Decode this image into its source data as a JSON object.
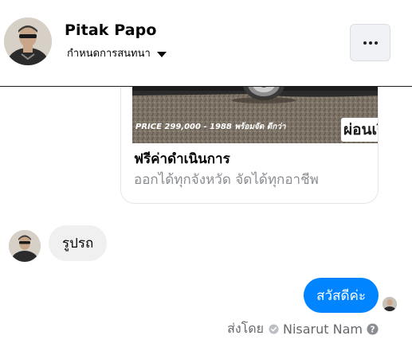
{
  "header": {
    "name": "Pitak Papo",
    "subtitle": "กำหนดการสนทนา",
    "more_icon": "more-horizontal-icon"
  },
  "ad_card": {
    "image_caption_left": "PRICE 299,000 - 1988 พร้อมจัด ดีกว่า",
    "image_caption_right": "ผ่อนเริ่",
    "title": "ฟรีค่าดำเนินการ",
    "description": "ออกได้ทุกจังหวัด จัดได้ทุกอาชีพ"
  },
  "messages": {
    "incoming_text": "รูปรถ",
    "outgoing_text": "สวัสดีค่ะ"
  },
  "sent_by": {
    "prefix": "ส่งโดย",
    "name": "Nisarut Nam"
  },
  "colors": {
    "outgoing_bubble": "#0084ff",
    "incoming_bubble": "#f0f0f0",
    "header_border": "#1c1e21",
    "secondary_text": "#65676b"
  }
}
